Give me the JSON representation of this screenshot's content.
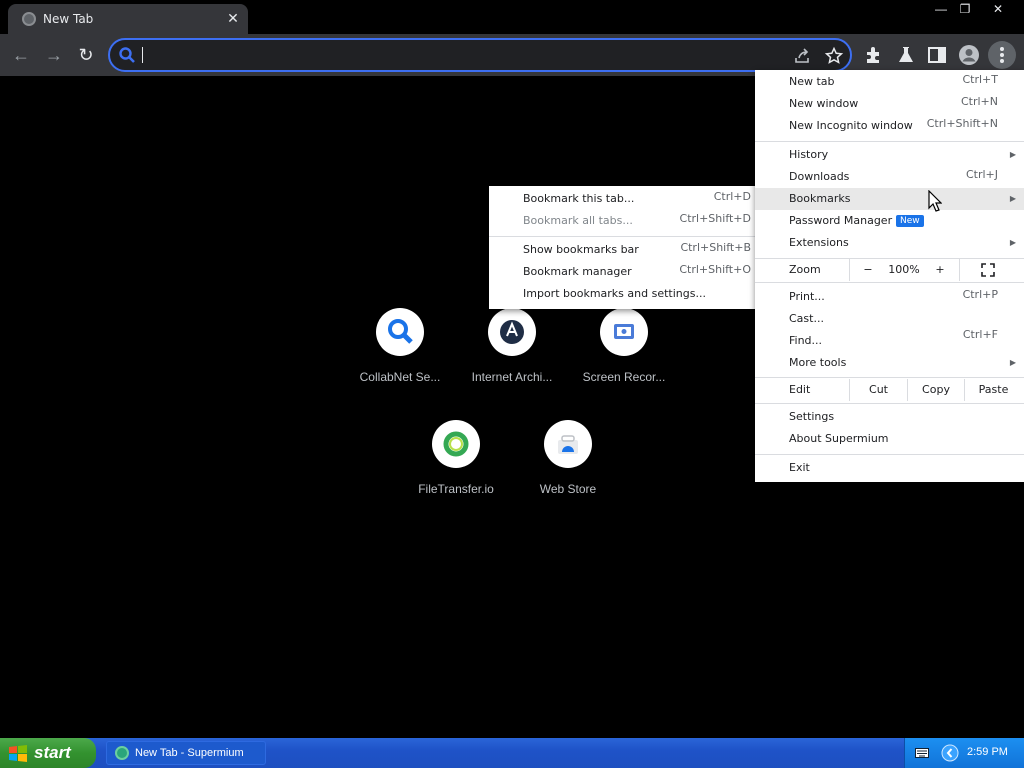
{
  "tab": {
    "title": "New Tab",
    "close": "✕"
  },
  "window_controls": {
    "minimize": "—",
    "restore": "❐",
    "close": "✕"
  },
  "toolbar": {
    "back": "←",
    "forward": "→",
    "reload": "↻",
    "omnibox_value": ""
  },
  "shortcuts": [
    {
      "label": "CollabNet Se...",
      "icon": "magnifier-icon"
    },
    {
      "label": "Internet Archi...",
      "icon": "archive-icon"
    },
    {
      "label": "Screen Recor...",
      "icon": "screen-recorder-icon"
    },
    {
      "label": "FileTransfer.io",
      "icon": "filetransfer-icon"
    },
    {
      "label": "Web Store",
      "icon": "web-store-icon"
    }
  ],
  "bookmarks_submenu": {
    "items": [
      {
        "label": "Bookmark this tab...",
        "accel": "Ctrl+D"
      },
      {
        "label": "Bookmark all tabs...",
        "accel": "Ctrl+Shift+D",
        "disabled": true
      },
      {
        "label": "Show bookmarks bar",
        "accel": "Ctrl+Shift+B"
      },
      {
        "label": "Bookmark manager",
        "accel": "Ctrl+Shift+O"
      },
      {
        "label": "Import bookmarks and settings..."
      }
    ]
  },
  "main_menu": {
    "new_tab": {
      "label": "New tab",
      "accel": "Ctrl+T"
    },
    "new_window": {
      "label": "New window",
      "accel": "Ctrl+N"
    },
    "new_incognito": {
      "label": "New Incognito window",
      "accel": "Ctrl+Shift+N"
    },
    "history": {
      "label": "History"
    },
    "downloads": {
      "label": "Downloads",
      "accel": "Ctrl+J"
    },
    "bookmarks": {
      "label": "Bookmarks"
    },
    "password_manager": {
      "label": "Password Manager",
      "badge": "New"
    },
    "extensions": {
      "label": "Extensions"
    },
    "zoom": {
      "label": "Zoom",
      "minus": "−",
      "value": "100%",
      "plus": "+"
    },
    "print": {
      "label": "Print...",
      "accel": "Ctrl+P"
    },
    "cast": {
      "label": "Cast..."
    },
    "find": {
      "label": "Find...",
      "accel": "Ctrl+F"
    },
    "more_tools": {
      "label": "More tools"
    },
    "edit": {
      "label": "Edit",
      "cut": "Cut",
      "copy": "Copy",
      "paste": "Paste"
    },
    "settings": {
      "label": "Settings"
    },
    "about": {
      "label": "About Supermium"
    },
    "exit": {
      "label": "Exit"
    }
  },
  "taskbar": {
    "start": "start",
    "task": "New Tab - Supermium",
    "clock": "2:59 PM"
  },
  "colors": {
    "accent": "#3d6ff2",
    "badge": "#1a73e8",
    "taskbar": "#1f53c8",
    "start": "#33922f"
  }
}
